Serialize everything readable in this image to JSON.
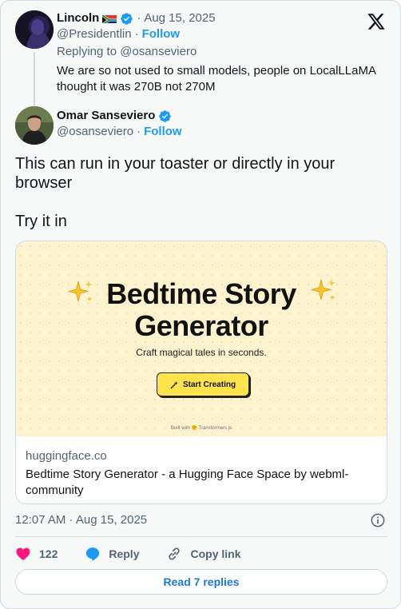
{
  "parent_tweet": {
    "name": "Lincoln",
    "handle": "@Presidentlin",
    "separator": "·",
    "date": "Aug 15, 2025",
    "follow_label": "Follow",
    "replying_to": "Replying to @osanseviero",
    "text": "We are so not used to small models, people on LocalLLaMA thought it was 270B not 270M"
  },
  "main_tweet": {
    "name": "Omar Sanseviero",
    "handle": "@osanseviero",
    "separator": "·",
    "follow_label": "Follow",
    "text_line1": "This can run in your toaster or directly in your browser",
    "text_line2": "Try it in"
  },
  "link_card": {
    "preview": {
      "title_line1": "Bedtime Story",
      "title_line2": "Generator",
      "subtitle": "Craft magical tales in seconds.",
      "button_label": "Start Creating",
      "built_with": "Built with 🤗 Transformers.js"
    },
    "domain": "huggingface.co",
    "title": "Bedtime Story Generator - a Hugging Face Space by webml-community"
  },
  "timestamp": "12:07 AM · Aug 15, 2025",
  "actions": {
    "like_count": "122",
    "reply_label": "Reply",
    "copy_label": "Copy link"
  },
  "read_replies_label": "Read 7 replies",
  "colors": {
    "accent": "#1d9bf0",
    "like": "#f91880",
    "preview_bg": "#fdf3cf",
    "button_yellow": "#ffe34d"
  },
  "icons": [
    "x-logo-icon",
    "verified-badge-icon",
    "south-africa-flag-icon",
    "sparkle-icon",
    "heart-icon",
    "reply-bubble-icon",
    "link-icon",
    "info-icon"
  ]
}
